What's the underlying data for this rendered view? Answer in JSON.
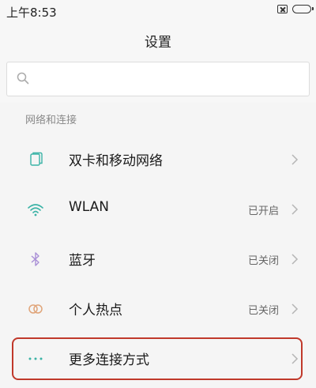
{
  "status_bar": {
    "time": "上午8:53",
    "icons": [
      "sim-off-icon",
      "battery-icon"
    ]
  },
  "header": {
    "title": "设置"
  },
  "search": {
    "placeholder": "",
    "value": ""
  },
  "section": {
    "label": "网络和连接"
  },
  "items": [
    {
      "label": "双卡和移动网络",
      "status": "",
      "icon": "dual-sim-icon"
    },
    {
      "label": "WLAN",
      "status": "已开启",
      "icon": "wifi-icon"
    },
    {
      "label": "蓝牙",
      "status": "已关闭",
      "icon": "bluetooth-icon"
    },
    {
      "label": "个人热点",
      "status": "已关闭",
      "icon": "hotspot-icon"
    },
    {
      "label": "更多连接方式",
      "status": "",
      "icon": "more-dots-icon"
    }
  ],
  "colors": {
    "accent": "#3bb3a6",
    "highlight": "#c0392b",
    "hotspot": "#e0a57a"
  }
}
